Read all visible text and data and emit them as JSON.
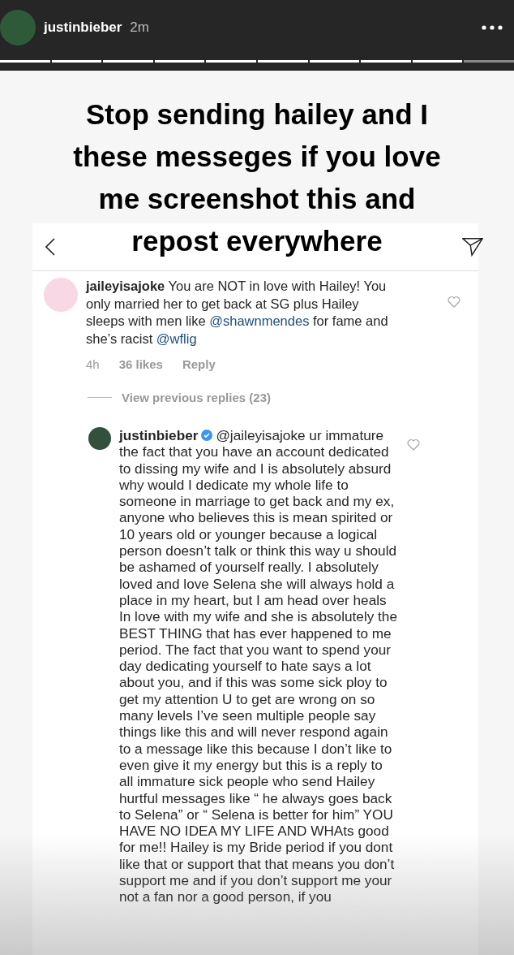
{
  "story_header": {
    "username": "justinbieber",
    "time": "2m"
  },
  "caption": "Stop sending hailey and I these messeges if you love me screenshot this and repost everywhere",
  "comment": {
    "username": "jaileyisajoke",
    "parts": [
      {
        "kind": "text",
        "text": "You are NOT in love with Hailey! You only married her to get back at SG plus Hailey sleeps with men like "
      },
      {
        "kind": "mention",
        "text": "@shawnmendes"
      },
      {
        "kind": "text",
        "text": " for fame and she’s racist "
      },
      {
        "kind": "mention",
        "text": "@wflig"
      }
    ],
    "time": "4h",
    "likes": "36 likes",
    "reply_label": "Reply"
  },
  "view_replies": "View previous replies (23)",
  "reply": {
    "username": "justinbieber",
    "verified": true,
    "parts": [
      {
        "kind": "mention",
        "text": "@jaileyisajoke"
      },
      {
        "kind": "text",
        "text": " ur immature the fact that you have an account dedicated to dissing my wife and I is absolutely absurd why would I dedicate my whole life to someone in marriage to get back and my ex, anyone who believes this is mean spirited or 10 years old or younger because a logical person doesn’t talk or think this way u should be ashamed of yourself really.  I absolutely loved and love Selena she will always hold a place in my heart, but I am head over heals In love with my wife and she is absolutely the BEST THING that has ever happened to me period. The fact that you want to spend your day dedicating yourself to hate says a lot about you, and if this was some sick ploy to get my attention U to get are wrong on so many levels I’ve seen multiple people say things like this and will never respond again to a message like this because I don’t like to even give it my energy but this is a reply to all immature sick people who send Hailey hurtful messages like “ he always goes back to Selena” or “ Selena is better for him” YOU HAVE NO IDEA MY LIFE AND WHAts good for me!! Hailey is my Bride period if you dont like that or support that that means you don’t support me and if you don’t support me your not a fan nor a good person, if you"
      }
    ]
  }
}
